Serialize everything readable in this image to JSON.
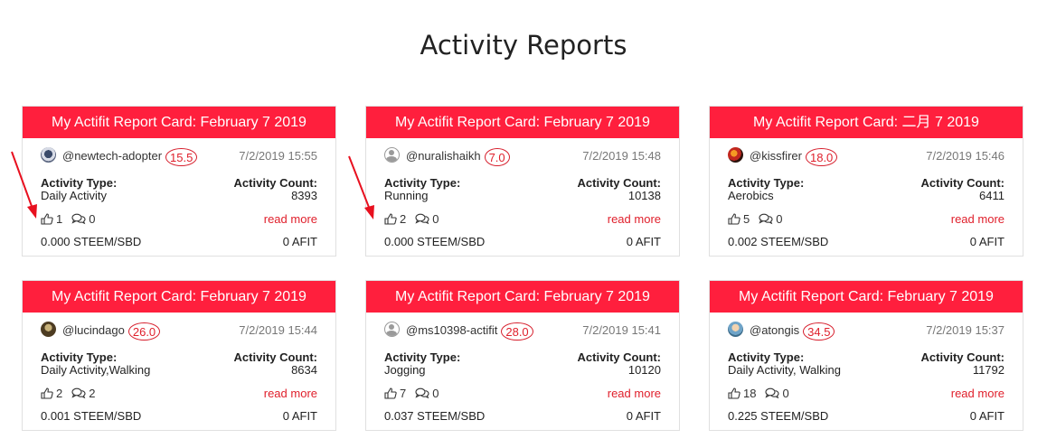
{
  "page": {
    "title": "Activity Reports"
  },
  "labels": {
    "activity_type": "Activity Type:",
    "activity_count": "Activity Count:",
    "read_more": "read more"
  },
  "colors": {
    "header_red": "#ff1f3d",
    "accent_red": "#e0202c"
  },
  "cards": [
    {
      "title": "My Actifit Report Card: February 7 2019",
      "username": "@newtech-adopter",
      "reputation": "15.5",
      "date": "7/2/2019 15:55",
      "activity_type": "Daily Activity",
      "activity_count": "8393",
      "likes": "1",
      "comments": "0",
      "steem": "0.000 STEEM/SBD",
      "afit": "0 AFIT",
      "avatar": "avatar-image"
    },
    {
      "title": "My Actifit Report Card: February 7 2019",
      "username": "@nuralishaikh",
      "reputation": "7.0",
      "date": "7/2/2019 15:48",
      "activity_type": "Running",
      "activity_count": "10138",
      "likes": "2",
      "comments": "0",
      "steem": "0.000 STEEM/SBD",
      "afit": "0 AFIT",
      "avatar": "default-user-icon"
    },
    {
      "title": "My Actifit Report Card: 二月 7 2019",
      "username": "@kissfirer",
      "reputation": "18.0",
      "date": "7/2/2019 15:46",
      "activity_type": "Aerobics",
      "activity_count": "6411",
      "likes": "5",
      "comments": "0",
      "steem": "0.002 STEEM/SBD",
      "afit": "0 AFIT",
      "avatar": "avatar-image"
    },
    {
      "title": "My Actifit Report Card: February 7 2019",
      "username": "@lucindago",
      "reputation": "26.0",
      "date": "7/2/2019 15:44",
      "activity_type": "Daily Activity,Walking",
      "activity_count": "8634",
      "likes": "2",
      "comments": "2",
      "steem": "0.001 STEEM/SBD",
      "afit": "0 AFIT",
      "avatar": "avatar-image"
    },
    {
      "title": "My Actifit Report Card: February 7 2019",
      "username": "@ms10398-actifit",
      "reputation": "28.0",
      "date": "7/2/2019 15:41",
      "activity_type": "Jogging",
      "activity_count": "10120",
      "likes": "7",
      "comments": "0",
      "steem": "0.037 STEEM/SBD",
      "afit": "0 AFIT",
      "avatar": "default-user-icon"
    },
    {
      "title": "My Actifit Report Card: February 7 2019",
      "username": "@atongis",
      "reputation": "34.5",
      "date": "7/2/2019 15:37",
      "activity_type": "Daily Activity, Walking",
      "activity_count": "11792",
      "likes": "18",
      "comments": "0",
      "steem": "0.225 STEEM/SBD",
      "afit": "0 AFIT",
      "avatar": "avatar-image"
    }
  ]
}
